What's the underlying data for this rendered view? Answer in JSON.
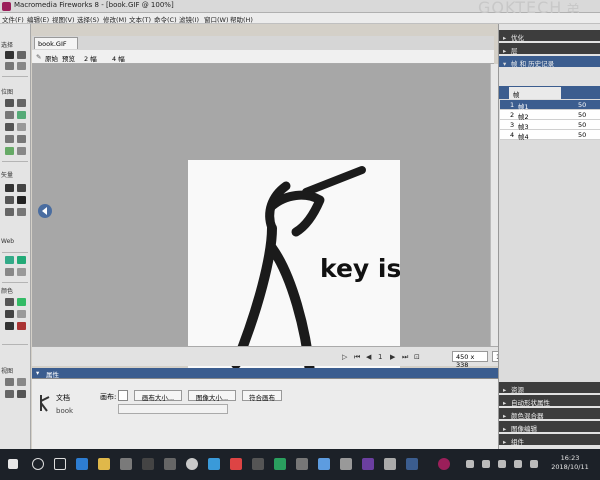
{
  "window": {
    "title": "Macromedia Fireworks 8 - [book.GIF @ 100%]",
    "watermark": "GOKTECH",
    "watermark2": "弟"
  },
  "menubar": {
    "items": [
      "文件(F)",
      "编辑(E)",
      "视图(V)",
      "选择(S)",
      "修改(M)",
      "文本(T)",
      "命令(C)",
      "滤镜(I)",
      "窗口(W)",
      "帮助(H)"
    ]
  },
  "tools": {
    "sections": [
      "选择",
      "位图",
      "矢量",
      "Web",
      "颜色",
      "视图"
    ]
  },
  "document": {
    "tab": "book.GIF",
    "view_buttons": [
      "原始",
      "预览",
      "2 幅",
      "4 幅"
    ],
    "canvas_text": "key is:",
    "size": "450 x 338",
    "zoom": "100%",
    "frame_number": "1"
  },
  "properties": {
    "header": "属性",
    "doc_label": "文档",
    "doc_name": "book",
    "canvas_label": "画布:",
    "button_canvas_size": "画布大小...",
    "button_image_size": "图像大小...",
    "button_fit": "符合画布"
  },
  "right_panel": {
    "top_heads": [
      "优化",
      "层",
      "帧 和 历史记录"
    ],
    "frames_tab": "帧",
    "frames": [
      {
        "num": "1",
        "name": "帧1",
        "delay": "50"
      },
      {
        "num": "2",
        "name": "帧2",
        "delay": "50"
      },
      {
        "num": "3",
        "name": "帧3",
        "delay": "50"
      },
      {
        "num": "4",
        "name": "帧4",
        "delay": "50"
      }
    ],
    "bottom_heads": [
      "资源",
      "自动形状属性",
      "颜色混合器",
      "图像编辑",
      "组件"
    ]
  },
  "taskbar": {
    "time": "16:23",
    "date": "2018/10/11"
  },
  "colors": {
    "panel_blue": "#3b5d8f",
    "canvas_grey": "#a7a7a7",
    "taskbar": "#1c2128"
  }
}
